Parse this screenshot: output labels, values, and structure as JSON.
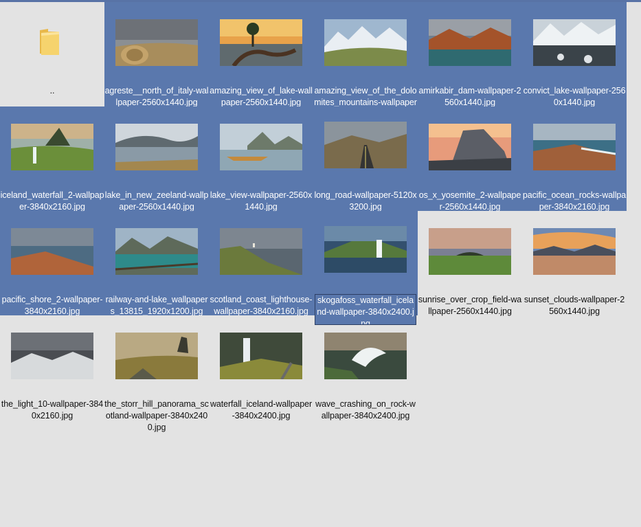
{
  "parent_folder": {
    "label": ".."
  },
  "files": [
    {
      "name": "agreste__north_of_italy-wallpaper-2560x1440.jpg",
      "selected": true,
      "thumb": "field"
    },
    {
      "name": "amazing_view_of_lake-wallpaper-2560x1440.jpg",
      "selected": true,
      "thumb": "lake-tree"
    },
    {
      "name": "amazing_view_of_the_dolomites_mountains-wallpaper",
      "selected": true,
      "thumb": "mountain"
    },
    {
      "name": "amirkabir_dam-wallpaper-2560x1440.jpg",
      "selected": true,
      "thumb": "dam"
    },
    {
      "name": "convict_lake-wallpaper-2560x1440.jpg",
      "selected": true,
      "thumb": "snow-lake"
    },
    {
      "name": "iceland_waterfall_2-wallpaper-3840x2160.jpg",
      "selected": true,
      "thumb": "iceland"
    },
    {
      "name": "lake_in_new_zeeland-wallpaper-2560x1440.jpg",
      "selected": true,
      "thumb": "nz-lake"
    },
    {
      "name": "lake_view-wallpaper-2560x1440.jpg",
      "selected": true,
      "thumb": "lake-view"
    },
    {
      "name": "long_road-wallpaper-5120x3200.jpg",
      "selected": true,
      "thumb": "road"
    },
    {
      "name": "os_x_yosemite_2-wallpaper-2560x1440.jpg",
      "selected": true,
      "thumb": "yosemite"
    },
    {
      "name": "pacific_ocean_rocks-wallpaper-3840x2160.jpg",
      "selected": true,
      "thumb": "ocean-rocks"
    },
    {
      "name": "pacific_shore_2-wallpaper-3840x2160.jpg",
      "selected": true,
      "thumb": "shore"
    },
    {
      "name": "railway-and-lake_wallpapers_13815_1920x1200.jpg",
      "selected": true,
      "thumb": "railway"
    },
    {
      "name": "scotland_coast_lighthouse-wallpaper-3840x2160.jpg",
      "selected": true,
      "thumb": "scotland"
    },
    {
      "name": "skogafoss_waterfall_iceland-wallpaper-3840x2400.jpg",
      "selected": true,
      "focused": true,
      "thumb": "skogafoss"
    },
    {
      "name": "sunrise_over_crop_field-wallpaper-2560x1440.jpg",
      "selected": false,
      "thumb": "crop"
    },
    {
      "name": "sunset_clouds-wallpaper-2560x1440.jpg",
      "selected": false,
      "thumb": "sunset"
    },
    {
      "name": "the_light_10-wallpaper-3840x2160.jpg",
      "selected": false,
      "thumb": "light"
    },
    {
      "name": "the_storr_hill_panorama_scotland-wallpaper-3840x2400.jpg",
      "selected": false,
      "thumb": "storr"
    },
    {
      "name": "waterfall_iceland-wallpaper-3840x2400.jpg",
      "selected": false,
      "thumb": "waterfall"
    },
    {
      "name": "wave_crashing_on_rock-wallpaper-3840x2400.jpg",
      "selected": false,
      "thumb": "wave"
    }
  ],
  "colors": {
    "selection": "#5a78ad",
    "background": "#e3e3e3",
    "accent_bar": "#5873a6"
  }
}
